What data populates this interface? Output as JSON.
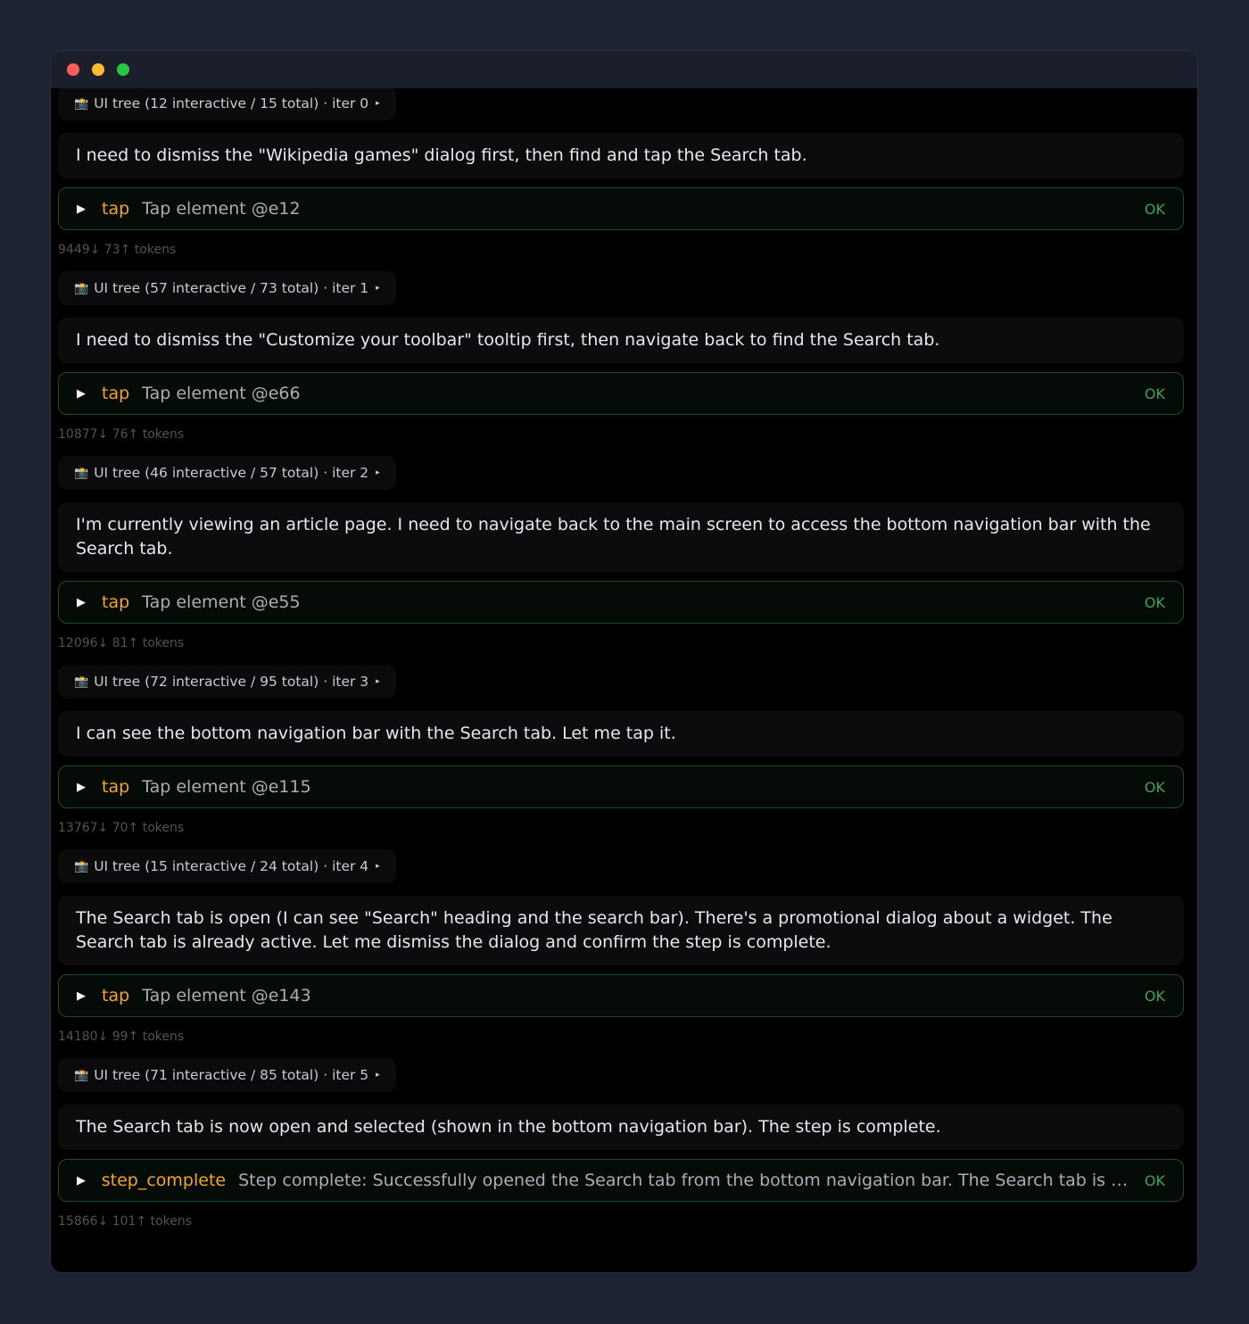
{
  "window": {
    "traffic_lights": [
      "close",
      "minimize",
      "maximize"
    ]
  },
  "colors": {
    "background": "#1d2230",
    "window_bg": "#000000",
    "accent_tool": "#f5a623",
    "status_ok": "#3fa35a",
    "tool_border": "#1e4a2a"
  },
  "iterations": [
    {
      "ui_tree_icon": "camera-flash-icon",
      "ui_tree_label": "UI tree (12 interactive / 15 total) · iter 0",
      "message": "I need to dismiss the \"Wikipedia games\" dialog first, then find and tap the Search tab.",
      "tool": "tap",
      "tool_desc": "Tap element @e12",
      "status": "OK",
      "tokens": "9449↓ 73↑ tokens"
    },
    {
      "ui_tree_icon": "camera-flash-icon",
      "ui_tree_label": "UI tree (57 interactive / 73 total) · iter 1",
      "message": "I need to dismiss the \"Customize your toolbar\" tooltip first, then navigate back to find the Search tab.",
      "tool": "tap",
      "tool_desc": "Tap element @e66",
      "status": "OK",
      "tokens": "10877↓ 76↑ tokens"
    },
    {
      "ui_tree_icon": "camera-flash-icon",
      "ui_tree_label": "UI tree (46 interactive / 57 total) · iter 2",
      "message": "I'm currently viewing an article page. I need to navigate back to the main screen to access the bottom navigation bar with the Search tab.",
      "tool": "tap",
      "tool_desc": "Tap element @e55",
      "status": "OK",
      "tokens": "12096↓ 81↑ tokens"
    },
    {
      "ui_tree_icon": "camera-flash-icon",
      "ui_tree_label": "UI tree (72 interactive / 95 total) · iter 3",
      "message": "I can see the bottom navigation bar with the Search tab. Let me tap it.",
      "tool": "tap",
      "tool_desc": "Tap element @e115",
      "status": "OK",
      "tokens": "13767↓ 70↑ tokens"
    },
    {
      "ui_tree_icon": "camera-flash-icon",
      "ui_tree_label": "UI tree (15 interactive / 24 total) · iter 4",
      "message": "The Search tab is open (I can see \"Search\" heading and the search bar). There's a promotional dialog about a widget. The Search tab is already active. Let me dismiss the dialog and confirm the step is complete.",
      "tool": "tap",
      "tool_desc": "Tap element @e143",
      "status": "OK",
      "tokens": "14180↓ 99↑ tokens"
    },
    {
      "ui_tree_icon": "camera-flash-icon",
      "ui_tree_label": "UI tree (71 interactive / 85 total) · iter 5",
      "message": "The Search tab is now open and selected (shown in the bottom navigation bar). The step is complete.",
      "tool": "step_complete",
      "tool_desc": "Step complete: Successfully opened the Search tab from the bottom navigation bar. The Search tab is no...",
      "status": "OK",
      "tokens": "15866↓ 101↑ tokens"
    }
  ]
}
